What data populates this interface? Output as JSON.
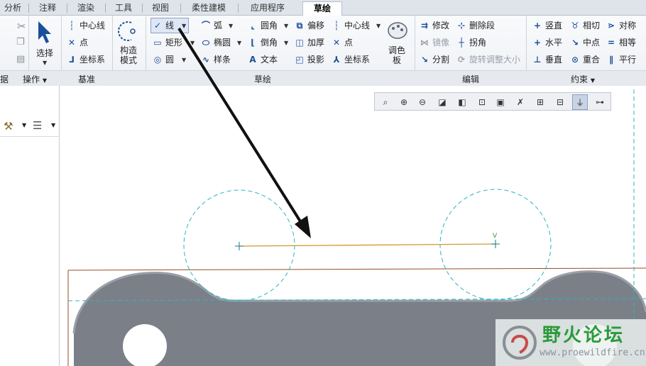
{
  "tabs": [
    "分析",
    "注释",
    "渲染",
    "工具",
    "视图",
    "柔性建模",
    "应用程序",
    "草绘"
  ],
  "active_tab": "草绘",
  "groups": {
    "clipboard_label": "据",
    "operations_label": "操作",
    "datum_label": "基准",
    "sketch_label": "草绘",
    "edit_label": "编辑",
    "constraints_label": "约束"
  },
  "operations": {
    "select": "选择"
  },
  "datum": {
    "centerline": "中心线",
    "point": "点",
    "coordsys": "坐标系"
  },
  "sketch": {
    "construction_mode_line1": "构造",
    "construction_mode_line2": "模式",
    "line": "线",
    "rectangle": "矩形",
    "circle": "圆",
    "arc": "弧",
    "ellipse": "椭圆",
    "spline": "样条",
    "fillet": "圆角",
    "chamfer": "倒角",
    "text": "文本",
    "offset": "偏移",
    "thicken": "加厚",
    "project": "投影",
    "centerline": "中心线",
    "point": "点",
    "coordsys": "坐标系",
    "palette_line1": "调色",
    "palette_line2": "板"
  },
  "edit": {
    "modify": "修改",
    "delete_segment": "删除段",
    "mirror": "镜像",
    "corner": "拐角",
    "divide": "分割",
    "rotate_resize": "旋转调整大小"
  },
  "constraints": {
    "vertical": "竖直",
    "tangent": "相切",
    "symmetric": "对称",
    "horizontal": "水平",
    "midpoint": "中点",
    "equal": "相等",
    "perpendicular": "垂直",
    "coincident": "重合",
    "parallel": "平行"
  },
  "canvas": {
    "constraint_marker": "V"
  },
  "watermark": {
    "title": "野火论坛",
    "url": "www.proewildfire.cn"
  },
  "colors": {
    "sketch_line": "#d19a2e",
    "construction": "#2bb5c2",
    "part": "#7b8088",
    "part_edge": "#9a4a2a"
  }
}
